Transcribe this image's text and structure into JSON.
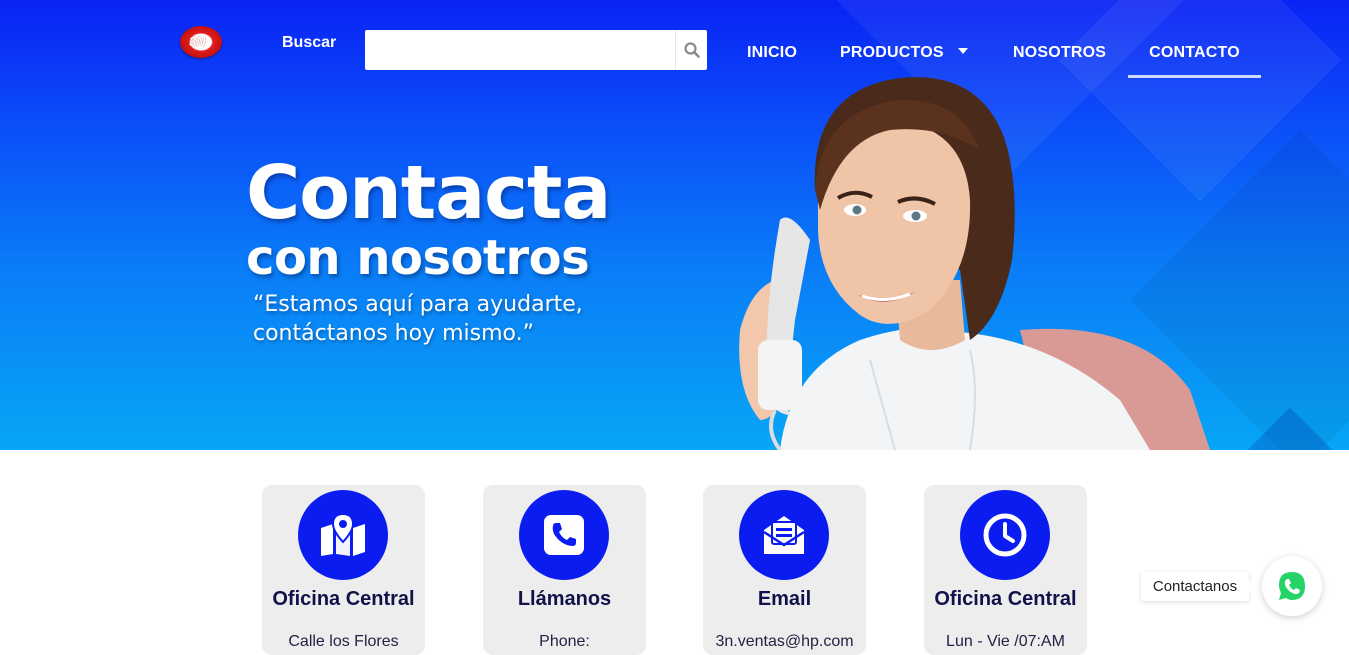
{
  "header": {
    "logo_text": "3N",
    "search_label": "Buscar",
    "search_placeholder": "",
    "search_value": ""
  },
  "nav": {
    "items": [
      {
        "label": "INICIO"
      },
      {
        "label": "PRODUCTOS"
      },
      {
        "label": "NOSOTROS"
      },
      {
        "label": "CONTACTO",
        "active": true
      }
    ]
  },
  "hero": {
    "title": "Contacta",
    "subtitle": "con nosotros",
    "quote_line1": "“Estamos aquí para ayudarte,",
    "quote_line2": "contáctanos hoy mismo.”"
  },
  "cards": [
    {
      "icon": "map-location-icon",
      "title": "Oficina Central",
      "detail": "Calle los Flores"
    },
    {
      "icon": "phone-icon",
      "title": "Llámanos",
      "detail": "Phone:"
    },
    {
      "icon": "envelope-icon",
      "title": "Email",
      "detail": "3n.ventas@hp.com"
    },
    {
      "icon": "clock-icon",
      "title": "Oficina Central",
      "detail": "Lun - Vie /07:AM"
    }
  ],
  "whatsapp": {
    "label": "Contactanos",
    "icon": "whatsapp-icon"
  },
  "colors": {
    "hero_top": "#0a22f5",
    "hero_bottom": "#07a6f6",
    "card_circle": "#0a1cf0",
    "card_bg": "#ededed",
    "card_title": "#12124a",
    "whatsapp_green": "#25d366"
  }
}
